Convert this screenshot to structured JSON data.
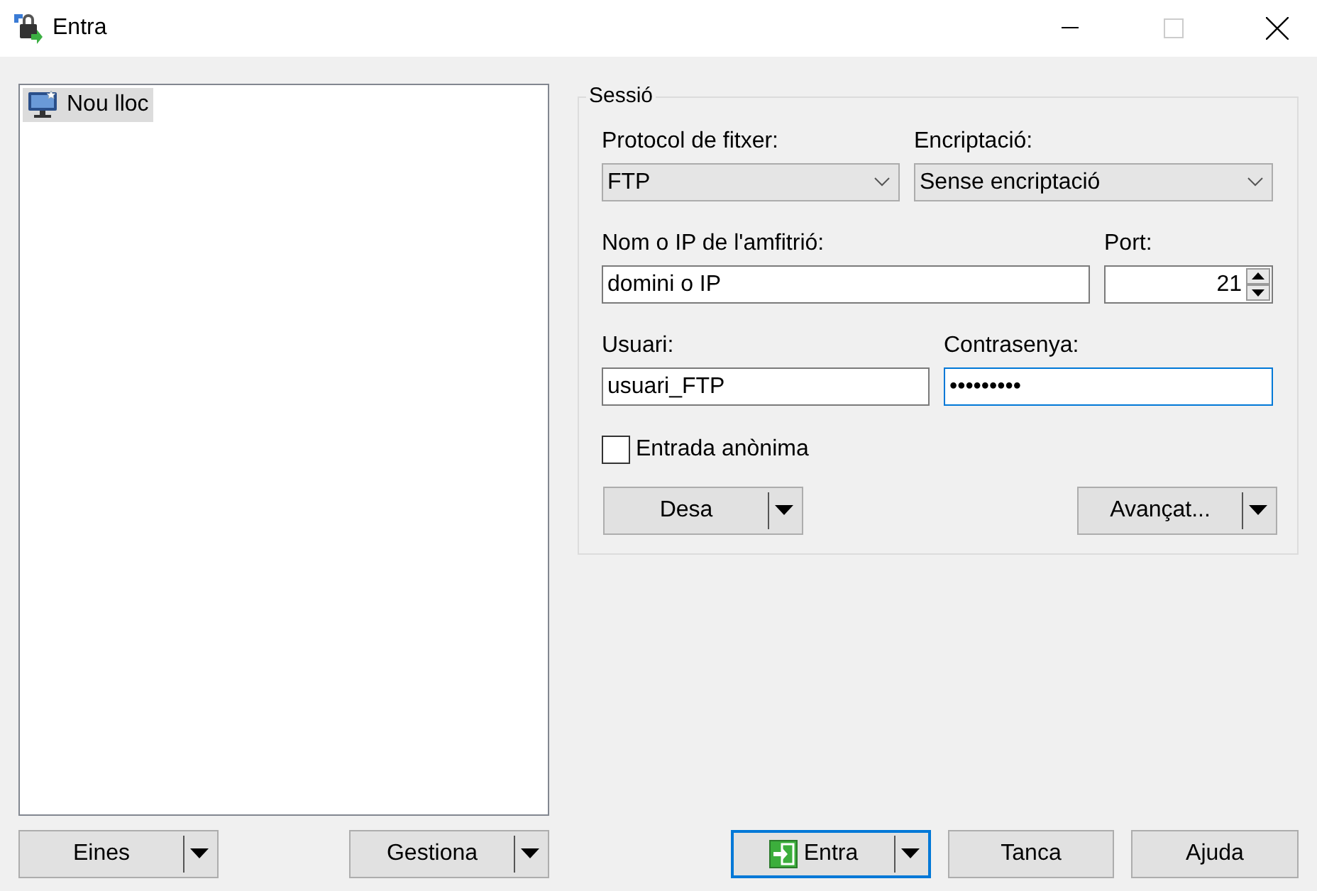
{
  "window": {
    "title": "Entra"
  },
  "sites": [
    {
      "label": "Nou lloc",
      "selected": true
    }
  ],
  "left_buttons": [
    {
      "label": "Eines",
      "kind": "split"
    },
    {
      "label": "Gestiona",
      "kind": "split"
    }
  ],
  "session": {
    "title": "Sessió",
    "protocol": {
      "label": "Protocol de fitxer:",
      "value": "FTP"
    },
    "encryption": {
      "label": "Encriptació:",
      "value": "Sense encriptació"
    },
    "host": {
      "label": "Nom o IP de l'amfitrió:",
      "value": "domini o IP"
    },
    "port": {
      "label": "Port:",
      "value": "21"
    },
    "user": {
      "label": "Usuari:",
      "value": "usuari_FTP",
      "focused": false
    },
    "password": {
      "label": "Contrasenya:",
      "value": "•••••••••",
      "focused": true
    },
    "anonymous": {
      "label": "Entrada anònima",
      "checked": false
    },
    "buttons": [
      {
        "label": "Desa",
        "kind": "split"
      },
      {
        "label": "Avançat...",
        "kind": "split"
      }
    ]
  },
  "dialog_buttons": [
    {
      "label": "Entra",
      "kind": "split",
      "default": true
    },
    {
      "label": "Tanca",
      "kind": "plain",
      "default": false
    },
    {
      "label": "Ajuda",
      "kind": "plain",
      "default": false
    }
  ]
}
